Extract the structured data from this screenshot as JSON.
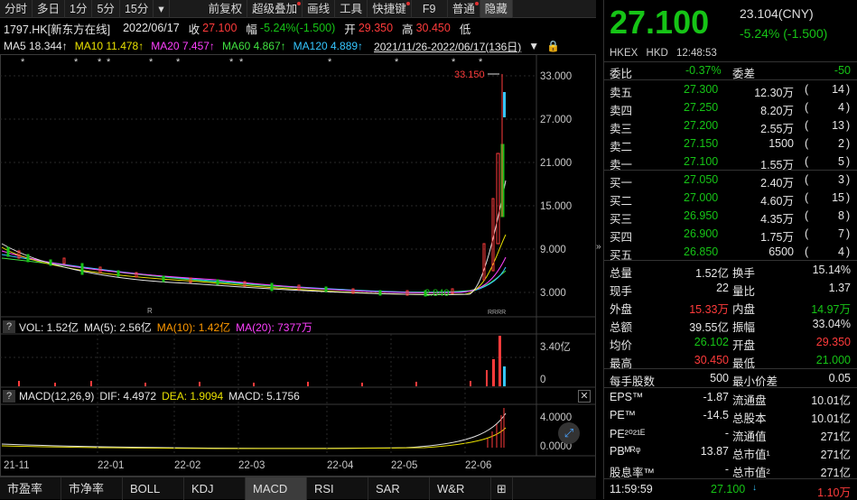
{
  "toolbar": {
    "items": [
      "分时",
      "多日",
      "1分",
      "5分",
      "15分",
      "▾",
      "前复权",
      "超级叠加",
      "画线",
      "工具",
      "快捷键",
      "F9",
      "普通",
      "隐藏"
    ]
  },
  "stock_header": {
    "code_name": "1797.HK[新东方在线]",
    "date": "2022/06/17",
    "close_label": "收",
    "close_value": "27.100",
    "change_label": "幅",
    "change_value": "-5.24%(-1.500)",
    "open_label": "开",
    "open_value": "29.350",
    "high_label": "高",
    "high_value": "30.450",
    "low_label": "低"
  },
  "ma_line": {
    "ma5": "MA5 18.344↑",
    "ma10": "MA10 11.478↑",
    "ma20": "MA20 7.457↑",
    "ma60": "MA60 4.867↑",
    "ma120": "MA120 4.889↑",
    "range": "2021/11/26-2022/06/17(136日)"
  },
  "price_axis": [
    "33.000",
    "27.000",
    "21.000",
    "15.000",
    "9.000",
    "3.000"
  ],
  "price_marks": {
    "high_label": "33.150",
    "low_label": "2.840",
    "r_label": "R",
    "rrrr_label": "RRRR"
  },
  "vol_header": {
    "vol": "VOL: 1.52亿",
    "ma5": "MA(5): 2.56亿",
    "ma10": "MA(10): 1.42亿",
    "ma20": "MA(20): 7377万"
  },
  "vol_axis": [
    "3.40亿",
    "0"
  ],
  "macd_header": {
    "name": "MACD(12,26,9)",
    "dif": "DIF: 4.4972",
    "dea": "DEA: 1.9094",
    "macd": "MACD: 5.1756"
  },
  "macd_axis": [
    "4.0000",
    "0.0000"
  ],
  "date_axis": [
    "21-11",
    "22-01",
    "22-02",
    "22-03",
    "22-04",
    "22-05",
    "22-06"
  ],
  "bottom_tabs": [
    "市盈率",
    "市净率",
    "BOLL",
    "KDJ",
    "MACD",
    "RSI",
    "SAR",
    "W&R"
  ],
  "colors": {
    "up": "#ff3b3b",
    "down": "#16c416",
    "ma5": "#e6e6e6",
    "ma10": "#e8e000",
    "ma20": "#ff40ff",
    "ma60": "#40e040",
    "ma120": "#35c6ff"
  },
  "quote": {
    "price": "27.100",
    "prev_close": "23.104(CNY)",
    "change": "-5.24% (-1.500)",
    "exchange": "HKEX",
    "currency": "HKD",
    "time": "12:48:53",
    "weibi_label": "委比",
    "weibi": "-0.37%",
    "weicha_label": "委差",
    "weicha": "-50",
    "asks": [
      {
        "label": "卖五",
        "price": "27.300",
        "vol": "12.30万",
        "count": "14"
      },
      {
        "label": "卖四",
        "price": "27.250",
        "vol": "8.20万",
        "count": "4"
      },
      {
        "label": "卖三",
        "price": "27.200",
        "vol": "2.55万",
        "count": "13"
      },
      {
        "label": "卖二",
        "price": "27.150",
        "vol": "1500",
        "count": "2"
      },
      {
        "label": "卖一",
        "price": "27.100",
        "vol": "1.55万",
        "count": "5"
      }
    ],
    "bids": [
      {
        "label": "买一",
        "price": "27.050",
        "vol": "2.40万",
        "count": "3"
      },
      {
        "label": "买二",
        "price": "27.000",
        "vol": "4.60万",
        "count": "15"
      },
      {
        "label": "买三",
        "price": "26.950",
        "vol": "4.35万",
        "count": "8"
      },
      {
        "label": "买四",
        "price": "26.900",
        "vol": "1.75万",
        "count": "7"
      },
      {
        "label": "买五",
        "price": "26.850",
        "vol": "6500",
        "count": "4"
      }
    ],
    "stats": [
      {
        "l1": "总量",
        "v1": "1.52亿",
        "c1": "white",
        "l2": "换手",
        "v2": "15.14%",
        "c2": "white"
      },
      {
        "l1": "现手",
        "v1": "22",
        "c1": "white",
        "l2": "量比",
        "v2": "1.37",
        "c2": "white"
      },
      {
        "l1": "外盘",
        "v1": "15.33万",
        "c1": "red",
        "l2": "内盘",
        "v2": "14.97万",
        "c2": "green"
      },
      {
        "l1": "总额",
        "v1": "39.55亿",
        "c1": "white",
        "l2": "振幅",
        "v2": "33.04%",
        "c2": "white"
      },
      {
        "l1": "均价",
        "v1": "26.102",
        "c1": "green",
        "l2": "开盘",
        "v2": "29.350",
        "c2": "red"
      },
      {
        "l1": "最高",
        "v1": "30.450",
        "c1": "red",
        "l2": "最低",
        "v2": "21.000",
        "c2": "green"
      }
    ],
    "lot_label": "每手股数",
    "lot": "500",
    "tick_label": "最小价差",
    "tick": "0.05",
    "fund": [
      {
        "l1": "EPS™",
        "v1": "-1.87",
        "l2": "流通盘",
        "v2": "10.01亿"
      },
      {
        "l1": "PE™",
        "v1": "-14.5",
        "l2": "总股本",
        "v2": "10.01亿"
      },
      {
        "l1": "PE²⁰²¹ᴱ",
        "v1": "-",
        "l2": "流通值",
        "v2": "271亿"
      },
      {
        "l1": "PBᴹᴿᵠ",
        "v1": "13.87",
        "l2": "总市值¹",
        "v2": "271亿"
      },
      {
        "l1": "股息率™",
        "v1": "-",
        "l2": "总市值²",
        "v2": "271亿"
      }
    ],
    "last_trade": {
      "time": "11:59:59",
      "price": "27.100",
      "vol": "1.10万"
    }
  }
}
